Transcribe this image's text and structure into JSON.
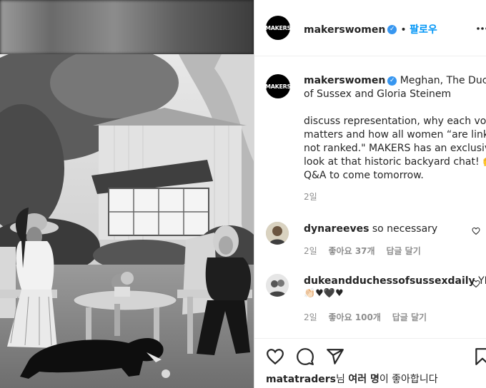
{
  "post": {
    "author": "makerswomen",
    "avatar_text": "MAKERS",
    "follow_label": "팔로우",
    "caption_author": "makerswomen",
    "caption_line1": "Meghan, The Duches",
    "caption_line2": "of Sussex and Gloria Steinem",
    "caption_body": [
      "discuss representation, why each vote",
      "matters and how all women “are linked,",
      "not ranked.\" MAKERS has an exclusive",
      "look at that historic backyard chat! 🙌",
      "Q&A to come tomorrow."
    ],
    "caption_time": "2일"
  },
  "comments": [
    {
      "user": "dynareeves",
      "text": "so necessary",
      "time": "2일",
      "likes": "좋아요 37개",
      "reply": "답글 달기"
    },
    {
      "user": "dukeandduchessofsussexdaily",
      "text": "YES!",
      "emoji": "👏🏻♥🖤♥",
      "time": "2일",
      "likes": "좋아요 100개",
      "reply": "답글 달기"
    }
  ],
  "likes_line": {
    "user": "matatraders",
    "suffix1": "님 ",
    "others": "여러 명",
    "suffix2": "이 좋아합니다"
  },
  "icons": [
    "heart-icon",
    "comment-icon",
    "share-icon",
    "bookmark-icon",
    "verified-badge-icon",
    "more-options-icon"
  ],
  "colors": {
    "accent": "#0095f6",
    "verified": "#3897f0",
    "muted": "#8e8e8e",
    "text": "#262626"
  }
}
